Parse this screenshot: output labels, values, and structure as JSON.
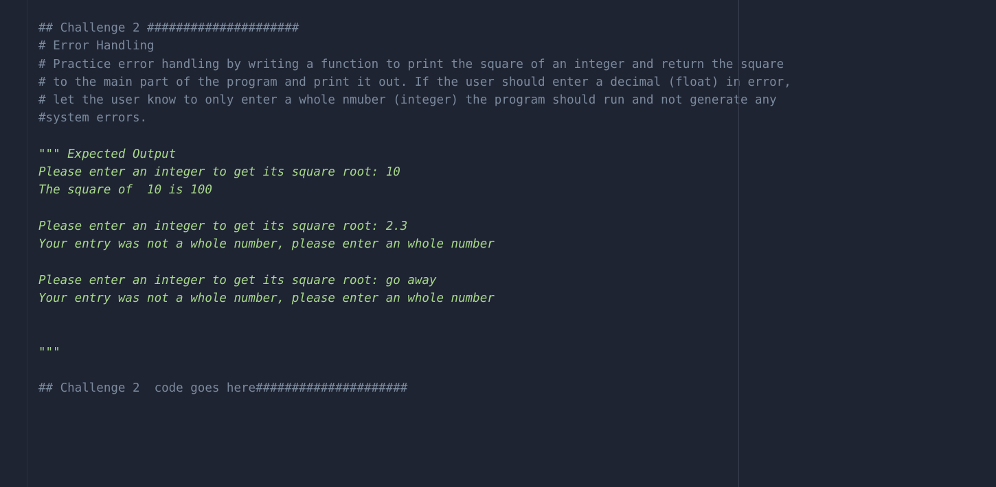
{
  "code": {
    "lines": [
      {
        "cls": "comment",
        "text": "## Challenge 2 #####################"
      },
      {
        "cls": "comment",
        "text": "# Error Handling"
      },
      {
        "cls": "comment",
        "text": "# Practice error handling by writing a function to print the square of an integer and return the square"
      },
      {
        "cls": "comment",
        "text": "# to the main part of the program and print it out. If the user should enter a decimal (float) in error,"
      },
      {
        "cls": "comment",
        "text": "# let the user know to only enter a whole nmuber (integer) the program should run and not generate any"
      },
      {
        "cls": "comment",
        "text": "#system errors."
      },
      {
        "cls": "",
        "text": ""
      },
      {
        "cls": "docstring",
        "text": "\"\"\" Expected Output"
      },
      {
        "cls": "docstring",
        "text": "Please enter an integer to get its square root: 10"
      },
      {
        "cls": "docstring",
        "text": "The square of  10 is 100"
      },
      {
        "cls": "docstring",
        "text": ""
      },
      {
        "cls": "docstring",
        "text": "Please enter an integer to get its square root: 2.3"
      },
      {
        "cls": "docstring",
        "text": "Your entry was not a whole number, please enter an whole number"
      },
      {
        "cls": "docstring",
        "text": ""
      },
      {
        "cls": "docstring",
        "text": "Please enter an integer to get its square root: go away"
      },
      {
        "cls": "docstring",
        "text": "Your entry was not a whole number, please enter an whole number"
      },
      {
        "cls": "docstring",
        "text": ""
      },
      {
        "cls": "docstring",
        "text": ""
      },
      {
        "cls": "docstring",
        "text": "\"\"\""
      },
      {
        "cls": "",
        "text": ""
      },
      {
        "cls": "comment",
        "text": "## Challenge 2  code goes here#####################"
      }
    ]
  }
}
